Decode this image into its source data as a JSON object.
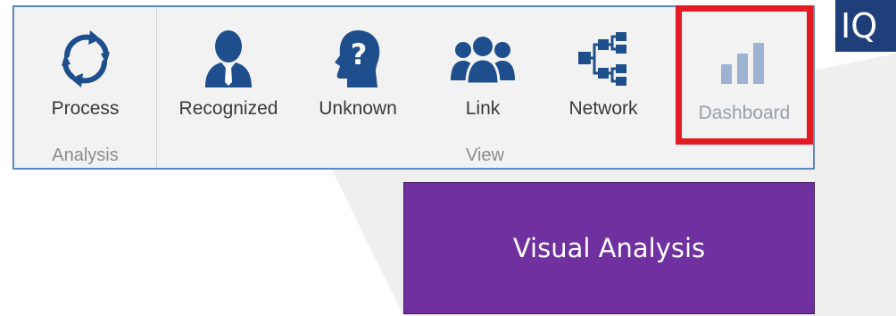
{
  "ribbon": {
    "groups": {
      "analysis": {
        "label": "Analysis",
        "buttons": {
          "process": {
            "label": "Process",
            "icon": "refresh-cycle-icon"
          }
        }
      },
      "view": {
        "label": "View",
        "buttons": {
          "recognized": {
            "label": "Recognized",
            "icon": "person-icon"
          },
          "unknown": {
            "label": "Unknown",
            "icon": "head-question-icon"
          },
          "link": {
            "label": "Link",
            "icon": "people-group-icon"
          },
          "network": {
            "label": "Network",
            "icon": "network-tree-icon"
          },
          "dashboard": {
            "label": "Dashboard",
            "icon": "bar-chart-icon",
            "state": "disabled",
            "highlight": "#e31b23"
          }
        }
      }
    }
  },
  "callout": {
    "text": "Visual Analysis"
  },
  "logo": {
    "text": "IQ"
  },
  "colors": {
    "ribbon_border": "#5b86c5",
    "icon_blue": "#1f4e8c",
    "icon_disabled": "#9db3d1",
    "callout_bg": "#7030a0",
    "highlight_red": "#e31b23"
  }
}
